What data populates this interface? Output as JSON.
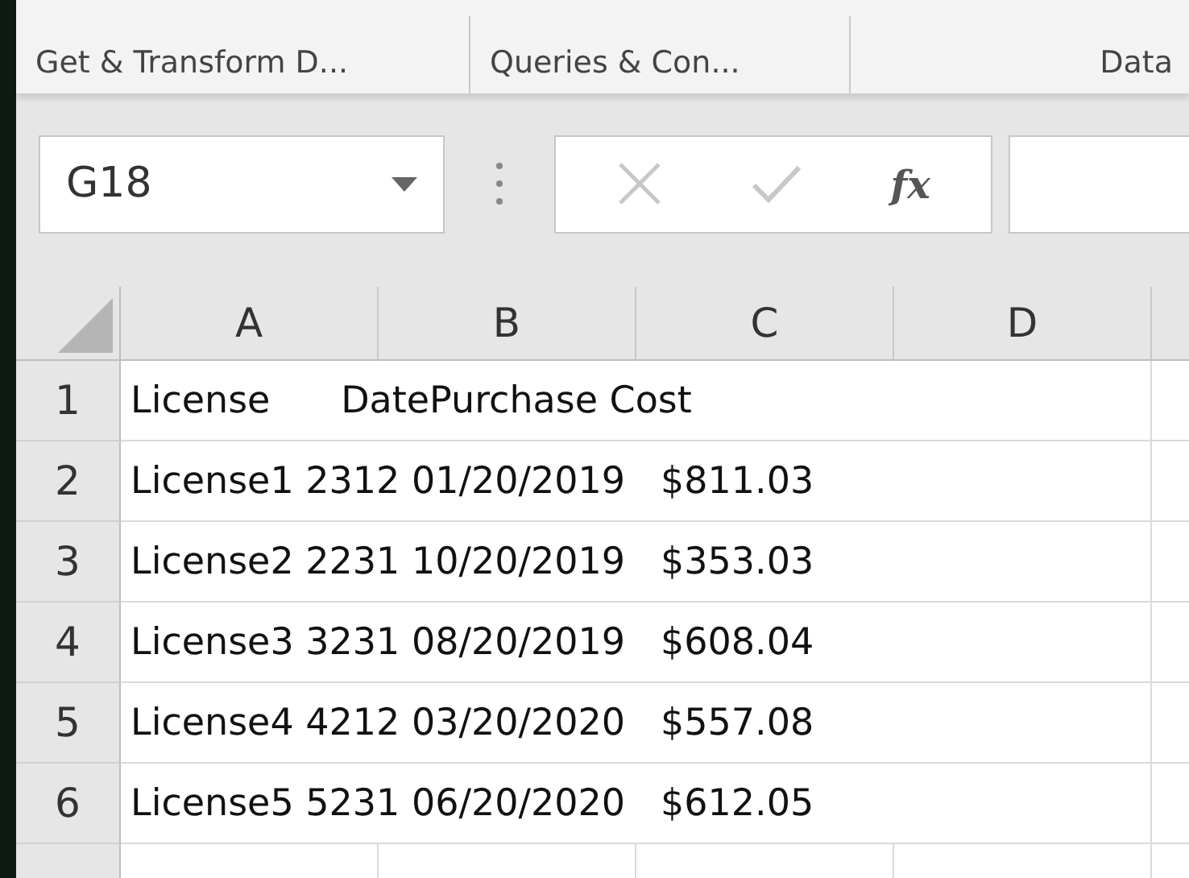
{
  "ribbon": {
    "groups": [
      "Get & Transform D...",
      "Queries & Con...",
      "Data"
    ]
  },
  "name_box": {
    "value": "G18"
  },
  "formula_bar": {
    "function_label": "fx"
  },
  "grid": {
    "columns": [
      "A",
      "B",
      "C",
      "D"
    ],
    "rows": [
      {
        "number": "1",
        "text": "License      DatePurchase Cost"
      },
      {
        "number": "2",
        "text": "License1 2312 01/20/2019   $811.03"
      },
      {
        "number": "3",
        "text": "License2 2231 10/20/2019   $353.03"
      },
      {
        "number": "4",
        "text": "License3 3231 08/20/2019   $608.04"
      },
      {
        "number": "5",
        "text": "License4 4212 03/20/2020   $557.08"
      },
      {
        "number": "6",
        "text": "License5 5231 06/20/2020   $612.05"
      }
    ]
  }
}
